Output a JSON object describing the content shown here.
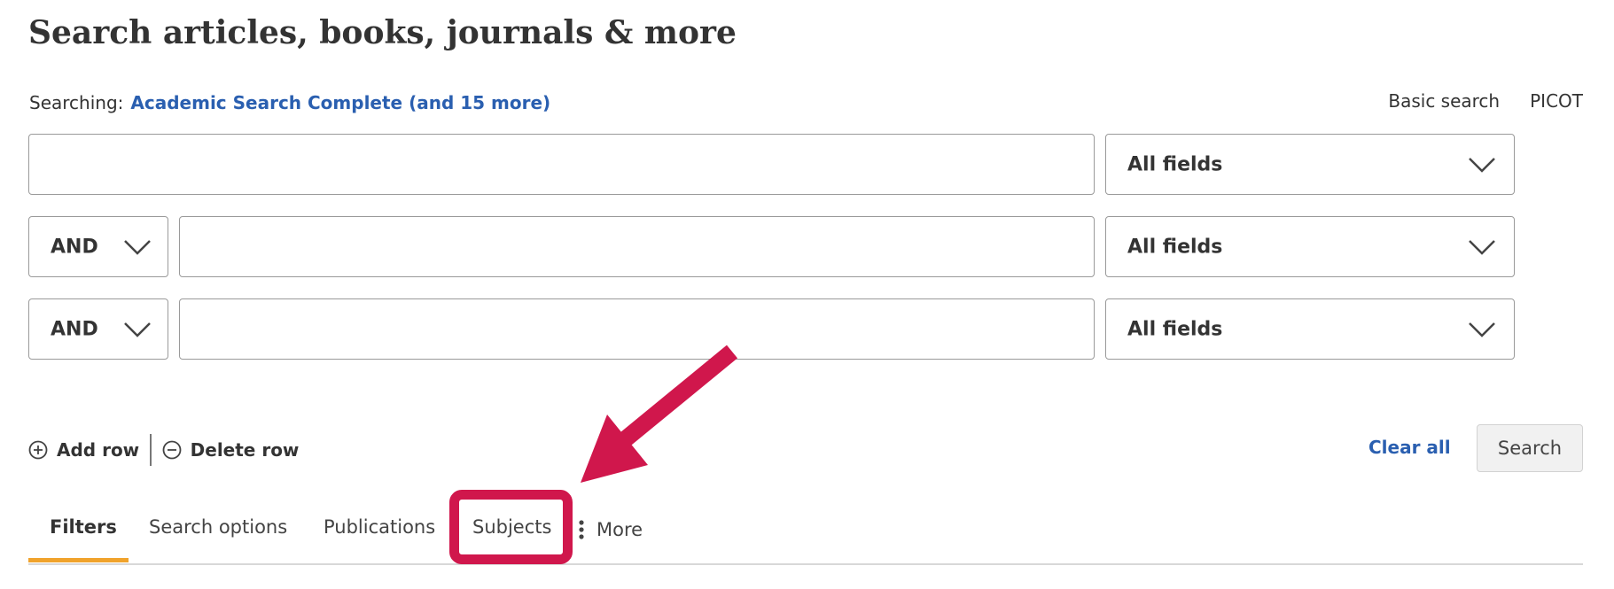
{
  "page": {
    "title": "Search articles, books, journals & more"
  },
  "searching": {
    "label": "Searching:",
    "databases_link": "Academic Search Complete (and 15 more)"
  },
  "top_links": {
    "basic_search": "Basic search",
    "picot": "PICOT"
  },
  "rows": [
    {
      "operator": null,
      "query": "",
      "field": "All fields"
    },
    {
      "operator": "AND",
      "query": "",
      "field": "All fields"
    },
    {
      "operator": "AND",
      "query": "",
      "field": "All fields"
    }
  ],
  "row_actions": {
    "add_row": "Add row",
    "delete_row": "Delete row"
  },
  "actions": {
    "clear_all": "Clear all",
    "search": "Search"
  },
  "tabs": [
    {
      "label": "Filters",
      "active": true
    },
    {
      "label": "Search options",
      "active": false
    },
    {
      "label": "Publications",
      "active": false
    },
    {
      "label": "Subjects",
      "active": false,
      "highlighted": true
    },
    {
      "label": "More",
      "active": false
    }
  ],
  "colors": {
    "link": "#2a5fb0",
    "active_tab_underline": "#f0a32c",
    "annotation": "#d0174c"
  }
}
